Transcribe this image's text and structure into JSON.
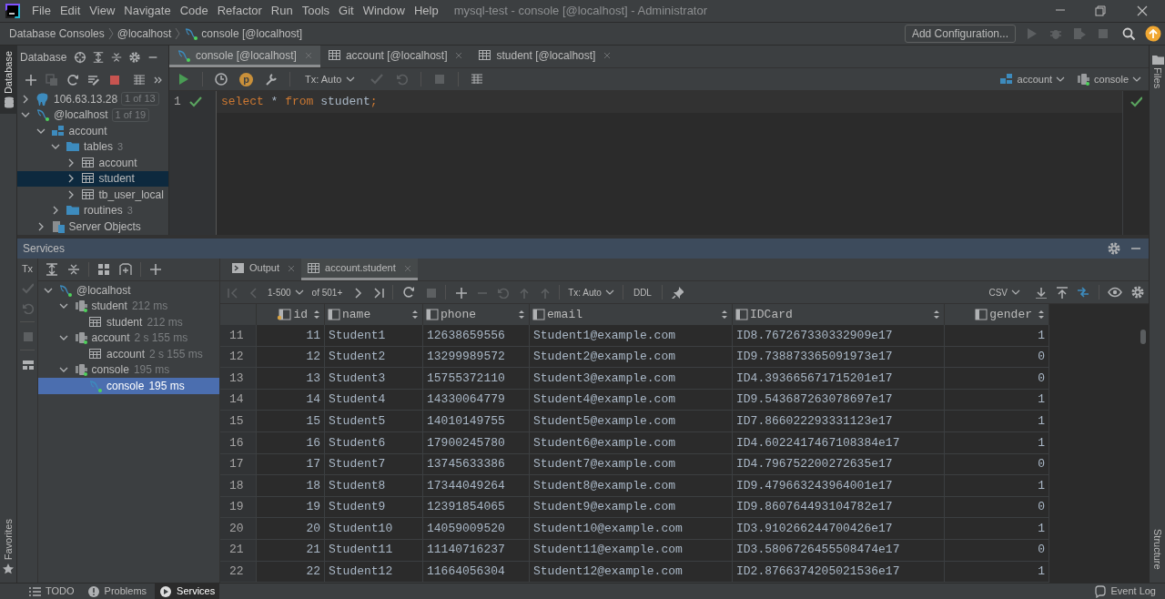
{
  "menu": [
    "File",
    "Edit",
    "View",
    "Navigate",
    "Code",
    "Refactor",
    "Run",
    "Tools",
    "Git",
    "Window",
    "Help"
  ],
  "window_title": "mysql-test - console [@localhost] - Administrator",
  "breadcrumbs": [
    {
      "label": "Database Consoles",
      "kind": "plain"
    },
    {
      "label": "@localhost",
      "kind": "plain"
    },
    {
      "label": "console [@localhost]",
      "kind": "console"
    }
  ],
  "run_configuration": "Add Configuration...",
  "left_stripe": {
    "top": "Database",
    "bottom": "Favorites"
  },
  "right_stripe": {
    "top": "Files",
    "bottom": "Structure"
  },
  "database_panel": {
    "title": "Database",
    "tree": [
      {
        "label": "106.63.13.28",
        "badge": "1 of 13",
        "kind": "postgres",
        "expanded": false,
        "selected": false
      },
      {
        "label": "@localhost",
        "badge": "1 of 19",
        "kind": "mysql",
        "expanded": true,
        "selected": false,
        "children": [
          {
            "label": "account",
            "kind": "schema",
            "expanded": true,
            "selected": false,
            "children": [
              {
                "label": "tables",
                "count": "3",
                "kind": "folder",
                "expanded": true,
                "selected": false,
                "children": [
                  {
                    "label": "account",
                    "kind": "table",
                    "expanded": false,
                    "selected": false
                  },
                  {
                    "label": "student",
                    "kind": "table",
                    "expanded": false,
                    "selected": true
                  },
                  {
                    "label": "tb_user_local",
                    "kind": "table",
                    "expanded": false,
                    "selected": false
                  }
                ]
              },
              {
                "label": "routines",
                "count": "3",
                "kind": "folder",
                "expanded": false,
                "selected": false
              }
            ]
          },
          {
            "label": "Server Objects",
            "kind": "server",
            "expanded": false,
            "selected": false
          }
        ]
      }
    ]
  },
  "editor_tabs": [
    {
      "label": "console [@localhost]",
      "kind": "console",
      "selected": true
    },
    {
      "label": "account [@localhost]",
      "kind": "table",
      "selected": false
    },
    {
      "label": "student [@localhost]",
      "kind": "table",
      "selected": false
    }
  ],
  "editor_toolbar": {
    "profile_badge": "p",
    "tx": "Tx: Auto",
    "schema": "account",
    "session": "console"
  },
  "editor": {
    "lines": [
      {
        "number": "1",
        "ok": true,
        "tokens": [
          {
            "text": "select",
            "kind": "keyword"
          },
          {
            "text": " * ",
            "kind": "plain"
          },
          {
            "text": "from",
            "kind": "keyword"
          },
          {
            "text": " student",
            "kind": "plain"
          },
          {
            "text": ";",
            "kind": "keyword"
          }
        ]
      }
    ]
  },
  "services": {
    "title": "Services",
    "tx": "Tx",
    "tree": [
      {
        "label": "@localhost",
        "kind": "mysql",
        "expanded": true,
        "selected": false,
        "children": [
          {
            "label": "student",
            "time": "212 ms",
            "kind": "session",
            "expanded": true,
            "selected": false,
            "children": [
              {
                "label": "student",
                "time": "212 ms",
                "kind": "table",
                "selected": false
              }
            ]
          },
          {
            "label": "account",
            "time": "2 s 155 ms",
            "kind": "session",
            "expanded": true,
            "selected": false,
            "children": [
              {
                "label": "account",
                "time": "2 s 155 ms",
                "kind": "table",
                "selected": false
              }
            ]
          },
          {
            "label": "console",
            "time": "195 ms",
            "kind": "session",
            "expanded": true,
            "selected": false,
            "children": [
              {
                "label": "console",
                "time": "195 ms",
                "kind": "console",
                "selected": true
              }
            ]
          }
        ]
      }
    ]
  },
  "result_tabs": [
    {
      "label": "Output",
      "kind": "output",
      "selected": false
    },
    {
      "label": "account.student",
      "kind": "table",
      "selected": true
    }
  ],
  "grid_toolbar": {
    "page": "1-500",
    "total": "of 501+",
    "tx": "Tx: Auto",
    "ddl": "DDL",
    "export": "CSV"
  },
  "table": {
    "columns": [
      {
        "label": "id",
        "kind": "number",
        "key": true
      },
      {
        "label": "name",
        "kind": "text",
        "key": false
      },
      {
        "label": "phone",
        "kind": "text",
        "key": false
      },
      {
        "label": "email",
        "kind": "text",
        "key": false
      },
      {
        "label": "IDCard",
        "kind": "text",
        "key": false
      },
      {
        "label": "gender",
        "kind": "number",
        "key": false
      }
    ],
    "rows": [
      {
        "row": "11",
        "cells": [
          "11",
          "Student1",
          "12638659556",
          "Student1@example.com",
          "ID8.767267330332909e17",
          "1"
        ]
      },
      {
        "row": "12",
        "cells": [
          "12",
          "Student2",
          "13299989572",
          "Student2@example.com",
          "ID9.738873365091973e17",
          "0"
        ]
      },
      {
        "row": "13",
        "cells": [
          "13",
          "Student3",
          "15755372110",
          "Student3@example.com",
          "ID4.393665671715201e17",
          "0"
        ]
      },
      {
        "row": "14",
        "cells": [
          "14",
          "Student4",
          "14330064779",
          "Student4@example.com",
          "ID9.543687263078697e17",
          "1"
        ]
      },
      {
        "row": "15",
        "cells": [
          "15",
          "Student5",
          "14010149755",
          "Student5@example.com",
          "ID7.866022293331123e17",
          "1"
        ]
      },
      {
        "row": "16",
        "cells": [
          "16",
          "Student6",
          "17900245780",
          "Student6@example.com",
          "ID4.6022417467108384e17",
          "1"
        ]
      },
      {
        "row": "17",
        "cells": [
          "17",
          "Student7",
          "13745633386",
          "Student7@example.com",
          "ID4.796752200272635e17",
          "0"
        ]
      },
      {
        "row": "18",
        "cells": [
          "18",
          "Student8",
          "17344049264",
          "Student8@example.com",
          "ID9.479663243964001e17",
          "1"
        ]
      },
      {
        "row": "19",
        "cells": [
          "19",
          "Student9",
          "12391854065",
          "Student9@example.com",
          "ID9.860764493104782e17",
          "0"
        ]
      },
      {
        "row": "20",
        "cells": [
          "20",
          "Student10",
          "14059009520",
          "Student10@example.com",
          "ID3.910266244700426e17",
          "1"
        ]
      },
      {
        "row": "21",
        "cells": [
          "21",
          "Student11",
          "11140716237",
          "Student11@example.com",
          "ID3.5806726455508474e17",
          "0"
        ]
      },
      {
        "row": "22",
        "cells": [
          "22",
          "Student12",
          "11664056304",
          "Student12@example.com",
          "ID2.8766374205021536e17",
          "1"
        ]
      }
    ]
  },
  "bottom_tabs": [
    {
      "label": "TODO",
      "kind": "todo",
      "selected": false
    },
    {
      "label": "Problems",
      "kind": "problems",
      "selected": false
    },
    {
      "label": "Services",
      "kind": "services",
      "selected": true
    }
  ],
  "event_log": "Event Log"
}
